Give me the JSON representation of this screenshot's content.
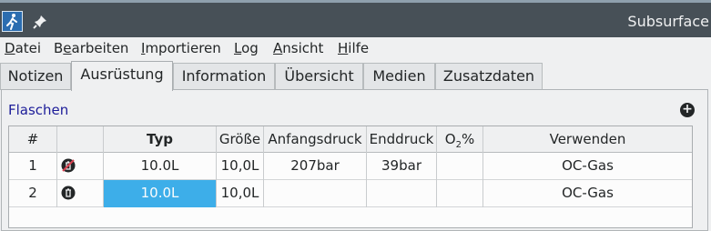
{
  "window": {
    "title": "Subsurface"
  },
  "icons": {
    "app": "subsurface-diver-icon",
    "pin": "pin-icon",
    "add": "add-cylinder-icon",
    "remove_disabled": "trash-disabled-icon",
    "remove": "trash-icon"
  },
  "menu": [
    {
      "label": "Datei",
      "mnemonic": "D",
      "rest": "atei"
    },
    {
      "label": "Bearbeiten",
      "pre": "B",
      "mnemonic": "e",
      "rest": "arbeiten"
    },
    {
      "label": "Importieren",
      "mnemonic": "I",
      "rest": "mportieren"
    },
    {
      "label": "Log",
      "mnemonic": "L",
      "rest": "og"
    },
    {
      "label": "Ansicht",
      "mnemonic": "A",
      "rest": "nsicht"
    },
    {
      "label": "Hilfe",
      "mnemonic": "H",
      "rest": "ilfe"
    }
  ],
  "tabs": [
    "Notizen",
    "Ausrüstung",
    "Information",
    "Übersicht",
    "Medien",
    "Zusatzdaten"
  ],
  "active_tab": "Ausrüstung",
  "section": {
    "title": "Flaschen"
  },
  "table": {
    "headers": {
      "num": "#",
      "typ": "Typ",
      "groesse": "Größe",
      "anfangsdruck": "Anfangsdruck",
      "enddruck": "Enddruck",
      "o2_pre": "O",
      "o2_sub": "2",
      "o2_post": "%",
      "verwenden": "Verwenden"
    },
    "rows": [
      {
        "num": "1",
        "typ": "10.0L",
        "groesse": "10,0L",
        "anfangsdruck": "207bar",
        "enddruck": "39bar",
        "o2": "",
        "verwenden": "OC-Gas"
      },
      {
        "num": "2",
        "typ": "10.0L",
        "groesse": "10,0L",
        "anfangsdruck": "",
        "enddruck": "",
        "o2": "",
        "verwenden": "OC-Gas"
      }
    ],
    "selected_cell": {
      "row": 2,
      "column": "Typ"
    }
  },
  "colors": {
    "titlebar": "#475057",
    "selection": "#3daee9",
    "section_title": "#1d1d99"
  }
}
